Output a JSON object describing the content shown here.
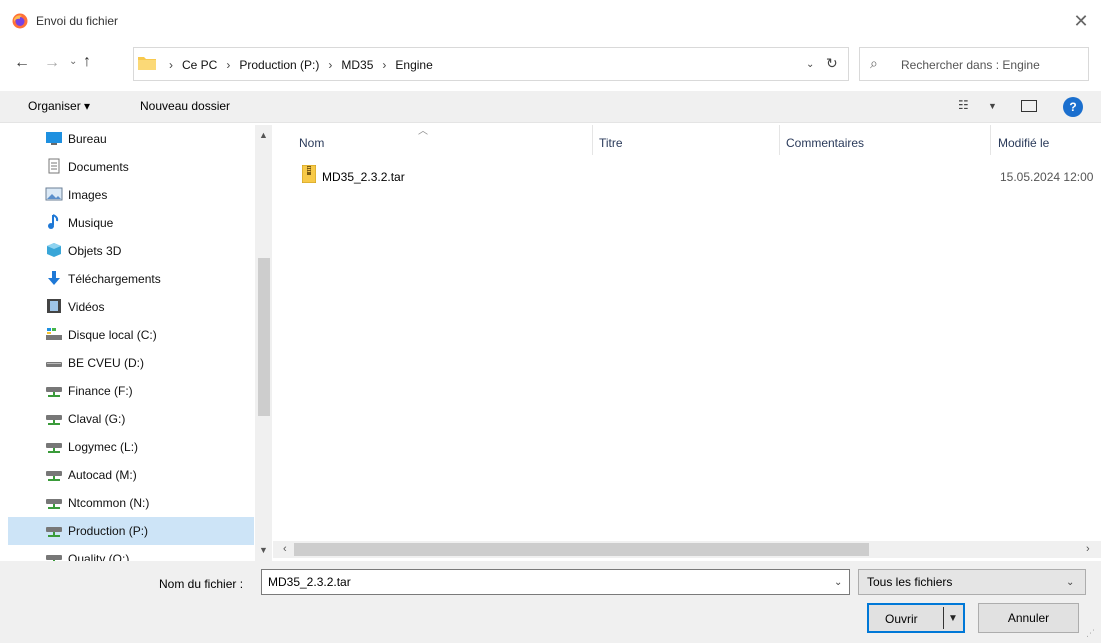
{
  "window": {
    "title": "Envoi du fichier"
  },
  "nav": {
    "back_icon": "arrow-left-icon",
    "forward_icon": "arrow-right-icon",
    "up_icon": "arrow-up-icon"
  },
  "breadcrumb": [
    "Ce PC",
    "Production (P:)",
    "MD35",
    "Engine"
  ],
  "search": {
    "placeholder": "Rechercher dans : Engine"
  },
  "toolbar": {
    "organise_label": "Organiser ▾",
    "new_folder_label": "Nouveau dossier",
    "help_label": "?"
  },
  "sidebar": {
    "items": [
      {
        "label": "Bureau",
        "icon": "desktop-icon"
      },
      {
        "label": "Documents",
        "icon": "documents-icon"
      },
      {
        "label": "Images",
        "icon": "images-icon"
      },
      {
        "label": "Musique",
        "icon": "music-icon"
      },
      {
        "label": "Objets 3D",
        "icon": "objects-3d-icon"
      },
      {
        "label": "Téléchargements",
        "icon": "downloads-icon"
      },
      {
        "label": "Vidéos",
        "icon": "videos-icon"
      },
      {
        "label": "Disque local (C:)",
        "icon": "local-disk-icon"
      },
      {
        "label": "BE CVEU (D:)",
        "icon": "drive-icon"
      },
      {
        "label": "Finance (F:)",
        "icon": "network-drive-icon"
      },
      {
        "label": "Claval (G:)",
        "icon": "network-drive-icon"
      },
      {
        "label": "Logymec (L:)",
        "icon": "network-drive-icon"
      },
      {
        "label": "Autocad (M:)",
        "icon": "network-drive-icon"
      },
      {
        "label": "Ntcommon (N:)",
        "icon": "network-drive-icon"
      },
      {
        "label": "Production (P:)",
        "icon": "network-drive-icon",
        "selected": true
      },
      {
        "label": "Quality (Q:)",
        "icon": "network-drive-icon"
      }
    ]
  },
  "columns": [
    "Nom",
    "Titre",
    "Commentaires",
    "Modifié le"
  ],
  "files": [
    {
      "name": "MD35_2.3.2.tar",
      "title": "",
      "comments": "",
      "modified": "15.05.2024 12:00"
    }
  ],
  "footer": {
    "filename_label": "Nom du fichier :",
    "filename_value": "MD35_2.3.2.tar",
    "filetype_value": "Tous les fichiers",
    "open_label": "Ouvrir",
    "cancel_label": "Annuler"
  },
  "colors": {
    "accent": "#0078d7",
    "selection": "#cde4f7",
    "help": "#1b6fce"
  }
}
